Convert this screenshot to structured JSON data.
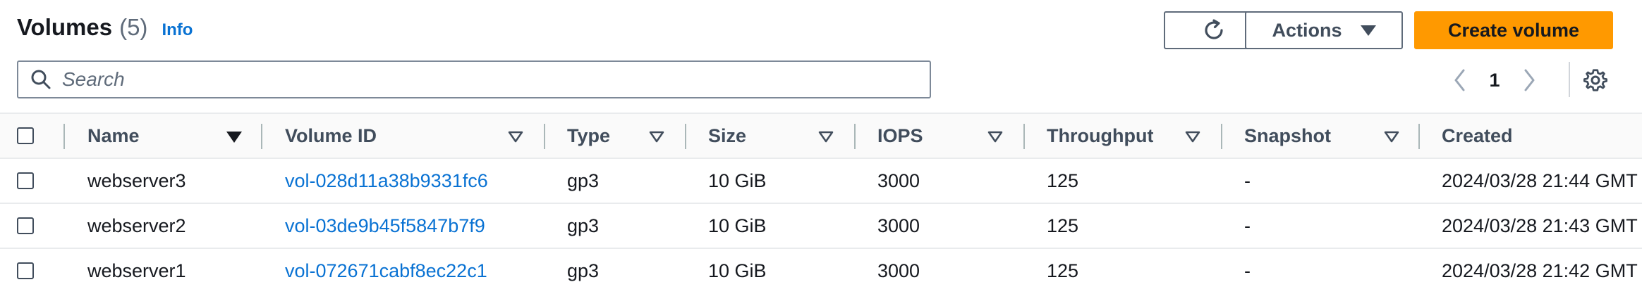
{
  "header": {
    "title": "Volumes",
    "count": "(5)",
    "info": "Info"
  },
  "toolbar": {
    "actions_label": "Actions",
    "create_label": "Create volume"
  },
  "search": {
    "placeholder": "Search"
  },
  "pagination": {
    "current_page": "1"
  },
  "table": {
    "columns": [
      "Name",
      "Volume ID",
      "Type",
      "Size",
      "IOPS",
      "Throughput",
      "Snapshot",
      "Created"
    ],
    "rows": [
      {
        "name": "webserver3",
        "volume_id": "vol-028d11a38b9331fc6",
        "type": "gp3",
        "size": "10 GiB",
        "iops": "3000",
        "throughput": "125",
        "snapshot": "-",
        "created": "2024/03/28 21:44 GMT"
      },
      {
        "name": "webserver2",
        "volume_id": "vol-03de9b45f5847b7f9",
        "type": "gp3",
        "size": "10 GiB",
        "iops": "3000",
        "throughput": "125",
        "snapshot": "-",
        "created": "2024/03/28 21:43 GMT"
      },
      {
        "name": "webserver1",
        "volume_id": "vol-072671cabf8ec22c1",
        "type": "gp3",
        "size": "10 GiB",
        "iops": "3000",
        "throughput": "125",
        "snapshot": "-",
        "created": "2024/03/28 21:42 GMT"
      }
    ]
  },
  "colors": {
    "accent": "#ff9900",
    "link": "#0972d3"
  },
  "icons": [
    "refresh-icon",
    "caret-down-icon",
    "search-icon",
    "chevron-left-icon",
    "chevron-right-icon",
    "gear-icon",
    "sort-desc-icon",
    "sort-icon"
  ]
}
